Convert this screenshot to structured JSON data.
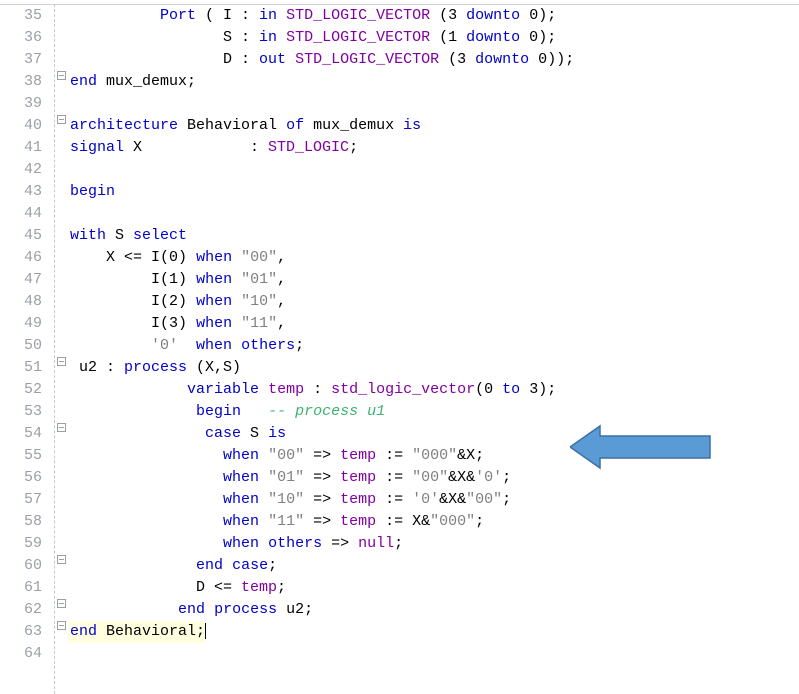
{
  "lines": [
    {
      "num": 35,
      "mark": "bar",
      "segs": [
        {
          "t": "          ",
          "c": ""
        },
        {
          "t": "Port",
          "c": "kw"
        },
        {
          "t": " ( I : ",
          "c": ""
        },
        {
          "t": "in",
          "c": "kw"
        },
        {
          "t": " ",
          "c": ""
        },
        {
          "t": "STD_LOGIC_VECTOR",
          "c": "fn"
        },
        {
          "t": " (",
          "c": ""
        },
        {
          "t": "3",
          "c": "num"
        },
        {
          "t": " ",
          "c": ""
        },
        {
          "t": "downto",
          "c": "kw"
        },
        {
          "t": " ",
          "c": ""
        },
        {
          "t": "0",
          "c": "num"
        },
        {
          "t": ");",
          "c": ""
        }
      ]
    },
    {
      "num": 36,
      "mark": "bar",
      "segs": [
        {
          "t": "                 S : ",
          "c": ""
        },
        {
          "t": "in",
          "c": "kw"
        },
        {
          "t": " ",
          "c": ""
        },
        {
          "t": "STD_LOGIC_VECTOR",
          "c": "fn"
        },
        {
          "t": " (",
          "c": ""
        },
        {
          "t": "1",
          "c": "num"
        },
        {
          "t": " ",
          "c": ""
        },
        {
          "t": "downto",
          "c": "kw"
        },
        {
          "t": " ",
          "c": ""
        },
        {
          "t": "0",
          "c": "num"
        },
        {
          "t": ");",
          "c": ""
        }
      ]
    },
    {
      "num": 37,
      "mark": "bar",
      "segs": [
        {
          "t": "                 D : ",
          "c": ""
        },
        {
          "t": "out",
          "c": "kw"
        },
        {
          "t": " ",
          "c": ""
        },
        {
          "t": "STD_LOGIC_VECTOR",
          "c": "fn"
        },
        {
          "t": " (",
          "c": ""
        },
        {
          "t": "3",
          "c": "num"
        },
        {
          "t": " ",
          "c": ""
        },
        {
          "t": "downto",
          "c": "kw"
        },
        {
          "t": " ",
          "c": ""
        },
        {
          "t": "0",
          "c": "num"
        },
        {
          "t": "));",
          "c": ""
        }
      ]
    },
    {
      "num": 38,
      "mark": "end",
      "segs": [
        {
          "t": "end",
          "c": "kw"
        },
        {
          "t": " mux_demux;",
          "c": ""
        }
      ]
    },
    {
      "num": 39,
      "mark": "bar",
      "segs": [
        {
          "t": "",
          "c": ""
        }
      ]
    },
    {
      "num": 40,
      "mark": "open",
      "segs": [
        {
          "t": "architecture",
          "c": "kw"
        },
        {
          "t": " Behavioral ",
          "c": ""
        },
        {
          "t": "of",
          "c": "kw"
        },
        {
          "t": " mux_demux ",
          "c": ""
        },
        {
          "t": "is",
          "c": "kw"
        }
      ]
    },
    {
      "num": 41,
      "mark": "bar",
      "segs": [
        {
          "t": "signal",
          "c": "kw"
        },
        {
          "t": " X            : ",
          "c": ""
        },
        {
          "t": "STD_LOGIC",
          "c": "fn"
        },
        {
          "t": ";",
          "c": ""
        }
      ]
    },
    {
      "num": 42,
      "mark": "",
      "segs": [
        {
          "t": "",
          "c": ""
        }
      ]
    },
    {
      "num": 43,
      "mark": "",
      "segs": [
        {
          "t": "begin",
          "c": "kw"
        }
      ]
    },
    {
      "num": 44,
      "mark": "",
      "segs": [
        {
          "t": "",
          "c": ""
        }
      ]
    },
    {
      "num": 45,
      "mark": "",
      "segs": [
        {
          "t": "with",
          "c": "kw"
        },
        {
          "t": " S ",
          "c": ""
        },
        {
          "t": "select",
          "c": "kw"
        }
      ]
    },
    {
      "num": 46,
      "mark": "",
      "segs": [
        {
          "t": "    X <= I(",
          "c": ""
        },
        {
          "t": "0",
          "c": "num"
        },
        {
          "t": ") ",
          "c": ""
        },
        {
          "t": "when",
          "c": "kw"
        },
        {
          "t": " ",
          "c": ""
        },
        {
          "t": "\"00\"",
          "c": "str"
        },
        {
          "t": ",",
          "c": ""
        }
      ]
    },
    {
      "num": 47,
      "mark": "",
      "segs": [
        {
          "t": "         I(",
          "c": ""
        },
        {
          "t": "1",
          "c": "num"
        },
        {
          "t": ") ",
          "c": ""
        },
        {
          "t": "when",
          "c": "kw"
        },
        {
          "t": " ",
          "c": ""
        },
        {
          "t": "\"01\"",
          "c": "str"
        },
        {
          "t": ",",
          "c": ""
        }
      ]
    },
    {
      "num": 48,
      "mark": "",
      "segs": [
        {
          "t": "         I(",
          "c": ""
        },
        {
          "t": "2",
          "c": "num"
        },
        {
          "t": ") ",
          "c": ""
        },
        {
          "t": "when",
          "c": "kw"
        },
        {
          "t": " ",
          "c": ""
        },
        {
          "t": "\"10\"",
          "c": "str"
        },
        {
          "t": ",",
          "c": ""
        }
      ]
    },
    {
      "num": 49,
      "mark": "",
      "segs": [
        {
          "t": "         I(",
          "c": ""
        },
        {
          "t": "3",
          "c": "num"
        },
        {
          "t": ") ",
          "c": ""
        },
        {
          "t": "when",
          "c": "kw"
        },
        {
          "t": " ",
          "c": ""
        },
        {
          "t": "\"11\"",
          "c": "str"
        },
        {
          "t": ",",
          "c": ""
        }
      ]
    },
    {
      "num": 50,
      "mark": "",
      "segs": [
        {
          "t": "         ",
          "c": ""
        },
        {
          "t": "'0'",
          "c": "str"
        },
        {
          "t": "  ",
          "c": ""
        },
        {
          "t": "when",
          "c": "kw"
        },
        {
          "t": " ",
          "c": ""
        },
        {
          "t": "others",
          "c": "kw"
        },
        {
          "t": ";",
          "c": ""
        }
      ]
    },
    {
      "num": 51,
      "mark": "open",
      "segs": [
        {
          "t": " u2 : ",
          "c": ""
        },
        {
          "t": "process",
          "c": "kw"
        },
        {
          "t": " (X,S)",
          "c": ""
        }
      ]
    },
    {
      "num": 52,
      "mark": "bar",
      "segs": [
        {
          "t": "             ",
          "c": ""
        },
        {
          "t": "variable",
          "c": "kw"
        },
        {
          "t": " ",
          "c": ""
        },
        {
          "t": "temp",
          "c": "fn"
        },
        {
          "t": " : ",
          "c": ""
        },
        {
          "t": "std_logic_vector",
          "c": "fn"
        },
        {
          "t": "(",
          "c": ""
        },
        {
          "t": "0",
          "c": "num"
        },
        {
          "t": " ",
          "c": ""
        },
        {
          "t": "to",
          "c": "kw"
        },
        {
          "t": " ",
          "c": ""
        },
        {
          "t": "3",
          "c": "num"
        },
        {
          "t": ");",
          "c": ""
        }
      ]
    },
    {
      "num": 53,
      "mark": "bar",
      "segs": [
        {
          "t": "              ",
          "c": ""
        },
        {
          "t": "begin",
          "c": "kw"
        },
        {
          "t": "   ",
          "c": ""
        },
        {
          "t": "-- process u1",
          "c": "cmt"
        }
      ]
    },
    {
      "num": 54,
      "mark": "open",
      "segs": [
        {
          "t": "               ",
          "c": ""
        },
        {
          "t": "case",
          "c": "kw"
        },
        {
          "t": " S ",
          "c": ""
        },
        {
          "t": "is",
          "c": "kw"
        }
      ]
    },
    {
      "num": 55,
      "mark": "bar",
      "segs": [
        {
          "t": "                 ",
          "c": ""
        },
        {
          "t": "when",
          "c": "kw"
        },
        {
          "t": " ",
          "c": ""
        },
        {
          "t": "\"00\"",
          "c": "str"
        },
        {
          "t": " => ",
          "c": ""
        },
        {
          "t": "temp",
          "c": "fn"
        },
        {
          "t": " := ",
          "c": ""
        },
        {
          "t": "\"000\"",
          "c": "str"
        },
        {
          "t": "&X;",
          "c": ""
        }
      ]
    },
    {
      "num": 56,
      "mark": "bar",
      "segs": [
        {
          "t": "                 ",
          "c": ""
        },
        {
          "t": "when",
          "c": "kw"
        },
        {
          "t": " ",
          "c": ""
        },
        {
          "t": "\"01\"",
          "c": "str"
        },
        {
          "t": " => ",
          "c": ""
        },
        {
          "t": "temp",
          "c": "fn"
        },
        {
          "t": " := ",
          "c": ""
        },
        {
          "t": "\"00\"",
          "c": "str"
        },
        {
          "t": "&X&",
          "c": ""
        },
        {
          "t": "'0'",
          "c": "str"
        },
        {
          "t": ";",
          "c": ""
        }
      ]
    },
    {
      "num": 57,
      "mark": "bar",
      "segs": [
        {
          "t": "                 ",
          "c": ""
        },
        {
          "t": "when",
          "c": "kw"
        },
        {
          "t": " ",
          "c": ""
        },
        {
          "t": "\"10\"",
          "c": "str"
        },
        {
          "t": " => ",
          "c": ""
        },
        {
          "t": "temp",
          "c": "fn"
        },
        {
          "t": " := ",
          "c": ""
        },
        {
          "t": "'0'",
          "c": "str"
        },
        {
          "t": "&X&",
          "c": ""
        },
        {
          "t": "\"00\"",
          "c": "str"
        },
        {
          "t": ";",
          "c": ""
        }
      ]
    },
    {
      "num": 58,
      "mark": "bar",
      "segs": [
        {
          "t": "                 ",
          "c": ""
        },
        {
          "t": "when",
          "c": "kw"
        },
        {
          "t": " ",
          "c": ""
        },
        {
          "t": "\"11\"",
          "c": "str"
        },
        {
          "t": " => ",
          "c": ""
        },
        {
          "t": "temp",
          "c": "fn"
        },
        {
          "t": " := X&",
          "c": ""
        },
        {
          "t": "\"000\"",
          "c": "str"
        },
        {
          "t": ";",
          "c": ""
        }
      ]
    },
    {
      "num": 59,
      "mark": "bar",
      "segs": [
        {
          "t": "                 ",
          "c": ""
        },
        {
          "t": "when",
          "c": "kw"
        },
        {
          "t": " ",
          "c": ""
        },
        {
          "t": "others",
          "c": "kw"
        },
        {
          "t": " => ",
          "c": ""
        },
        {
          "t": "null",
          "c": "fn"
        },
        {
          "t": ";",
          "c": ""
        }
      ]
    },
    {
      "num": 60,
      "mark": "end",
      "segs": [
        {
          "t": "              ",
          "c": ""
        },
        {
          "t": "end",
          "c": "kw"
        },
        {
          "t": " ",
          "c": ""
        },
        {
          "t": "case",
          "c": "kw"
        },
        {
          "t": ";",
          "c": ""
        }
      ]
    },
    {
      "num": 61,
      "mark": "bar",
      "segs": [
        {
          "t": "              D <= ",
          "c": ""
        },
        {
          "t": "temp",
          "c": "fn"
        },
        {
          "t": ";",
          "c": ""
        }
      ]
    },
    {
      "num": 62,
      "mark": "end",
      "segs": [
        {
          "t": "            ",
          "c": ""
        },
        {
          "t": "end",
          "c": "kw"
        },
        {
          "t": " ",
          "c": ""
        },
        {
          "t": "process",
          "c": "kw"
        },
        {
          "t": " u2;",
          "c": ""
        }
      ]
    },
    {
      "num": 63,
      "mark": "end",
      "hl": true,
      "cursor": true,
      "segs": [
        {
          "t": "end",
          "c": "kw"
        },
        {
          "t": " Behavioral;",
          "c": ""
        }
      ]
    }
  ],
  "truncated_num": "64"
}
